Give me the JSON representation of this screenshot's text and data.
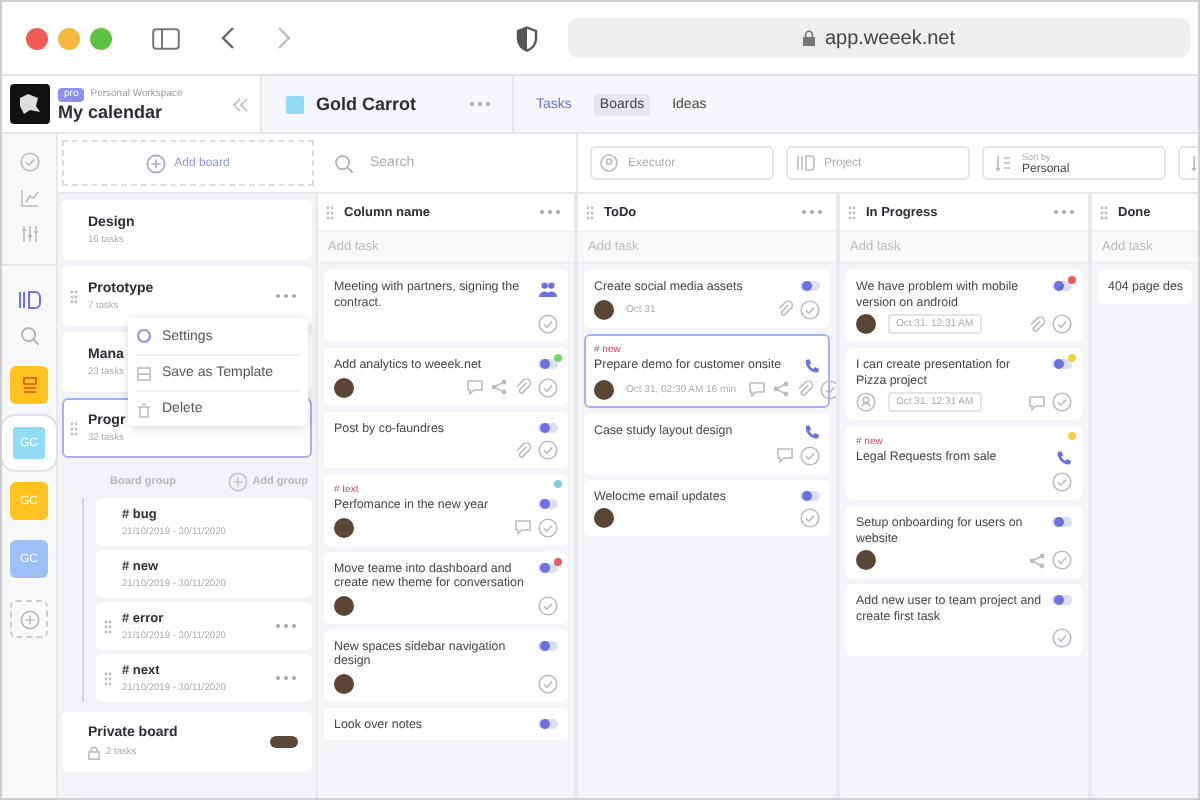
{
  "browser": {
    "address": "app.weeek.net"
  },
  "workspace": {
    "badge": "pro",
    "name": "Personal Workspace",
    "title": "My calendar"
  },
  "project": {
    "title": "Gold Carrot"
  },
  "tabs": [
    {
      "label": "Tasks",
      "kind": "link",
      "selected": false
    },
    {
      "label": "Boards",
      "kind": "tab",
      "selected": true
    },
    {
      "label": "Ideas",
      "kind": "tab",
      "selected": false
    }
  ],
  "rail": {
    "workspaces": [
      {
        "kind": "logo",
        "color": "#ffc31f",
        "selected": false
      },
      {
        "kind": "initials",
        "label": "GC",
        "color": "#8fdcf5",
        "selected": true
      },
      {
        "kind": "initials",
        "label": "GC",
        "color": "#ffc31f",
        "selected": false
      },
      {
        "kind": "initials",
        "label": "GC",
        "color": "#9ec0f7",
        "selected": false
      }
    ]
  },
  "add_board": {
    "label": "Add board"
  },
  "search": {
    "placeholder": "Search"
  },
  "filters": [
    {
      "kind": "executor",
      "placeholder": "Executor"
    },
    {
      "kind": "project",
      "placeholder": "Project"
    },
    {
      "kind": "sort",
      "label": "Sort by",
      "value": "Personal"
    }
  ],
  "boards": [
    {
      "title": "Design",
      "count": "16 tasks",
      "selected": false,
      "menu_open": false
    },
    {
      "title": "Prototype",
      "count": "7 tasks",
      "selected": false,
      "menu_open": true
    },
    {
      "title": "Mana",
      "count": "23 tasks",
      "selected": false,
      "menu_open": false
    },
    {
      "title": "Progr",
      "count": "32 tasks",
      "selected": true,
      "menu_open": false
    }
  ],
  "menu": {
    "items": [
      {
        "kind": "settings",
        "label": "Settings"
      },
      {
        "kind": "template",
        "label": "Save as Template"
      },
      {
        "kind": "delete",
        "label": "Delete"
      }
    ]
  },
  "board_group": {
    "label": "Board group",
    "add_label": "Add group",
    "groups": [
      {
        "title": "# bug",
        "dates": "21/10/2019 - 30/11/2020",
        "draggable": false
      },
      {
        "title": "# new",
        "dates": "21/10/2019 - 30/11/2020",
        "draggable": false
      },
      {
        "title": "# error",
        "dates": "21/10/2019 - 30/11/2020",
        "draggable": true
      },
      {
        "title": "# next",
        "dates": "21/10/2019 - 30/11/2020",
        "draggable": true
      }
    ]
  },
  "private_board": {
    "title": "Private board",
    "count": "2 tasks"
  },
  "columns": [
    {
      "title": "Column name",
      "add_placeholder": "Add task",
      "menu": true,
      "cards": [
        {
          "title": "Meeting with partners, signing the contract.",
          "kind": "meeting",
          "selected": false,
          "check": true
        },
        {
          "title": "Add analytics to weeek.net",
          "kind": "task",
          "color": "#7fd36f",
          "selected": false,
          "avatar": {
            "kind": "photo"
          },
          "comments": true,
          "shared": true,
          "attached": true,
          "check": true
        },
        {
          "title": "Post by co-faundres",
          "kind": "task",
          "selected": false,
          "attached": true,
          "check": true
        },
        {
          "tag": "# text",
          "title": "Perfomance in the new year",
          "kind": "task",
          "color": "#86cbe6",
          "selected": false,
          "avatar": {
            "kind": "photo"
          },
          "comments": true,
          "check": true
        },
        {
          "title": "Move teame into dashboard and create new theme for conversation",
          "kind": "task",
          "color": "#f0595b",
          "selected": false,
          "avatar": {
            "kind": "photo"
          },
          "check": true
        },
        {
          "title": "New spaces sidebar navigation design",
          "kind": "task",
          "selected": false,
          "avatar": {
            "kind": "photo"
          },
          "check": true
        },
        {
          "title": "Look over notes",
          "kind": "task",
          "selected": false
        }
      ]
    },
    {
      "title": "ToDo",
      "add_placeholder": "Add task",
      "menu": true,
      "cards": [
        {
          "title": "Create social media assets",
          "kind": "task",
          "selected": false,
          "avatar": {
            "kind": "photo"
          },
          "date": "Oct 31",
          "date_boxed": false,
          "attached": true,
          "check": true
        },
        {
          "tag": "# new",
          "title": "Prepare demo for customer onsite",
          "kind": "call",
          "selected": true,
          "avatar": {
            "kind": "photo"
          },
          "date": "Oct 31, 02:30 AM 16 min",
          "date_boxed": false,
          "comments": true,
          "shared": true,
          "attached": true,
          "check": true
        },
        {
          "title": "Case study layout design",
          "kind": "call",
          "selected": false,
          "comments": true,
          "check": true
        },
        {
          "title": "Welocme email updates",
          "kind": "task",
          "selected": false,
          "avatar": {
            "kind": "photo"
          },
          "check": true
        }
      ]
    },
    {
      "title": "In Progress",
      "add_placeholder": "Add task",
      "menu": true,
      "cards": [
        {
          "title": "We have problem with mobile version on android",
          "kind": "task",
          "color": "#f0595b",
          "selected": false,
          "avatar": {
            "kind": "photo"
          },
          "date": "Oct 31, 12:31 AM",
          "date_boxed": true,
          "attached": true,
          "check": true
        },
        {
          "title": "I can create presentation for Pizza project",
          "kind": "task",
          "color": "#f5cf3c",
          "selected": false,
          "avatar": {
            "kind": "empty"
          },
          "date": "Oct 31, 12:31 AM",
          "date_boxed": true,
          "comments": true,
          "check": true
        },
        {
          "tag": "# new",
          "title": "Legal Requests from sale",
          "kind": "call",
          "color": "#f5cf3c",
          "selected": false,
          "check": true
        },
        {
          "title": "Setup onboarding for users on website",
          "kind": "task",
          "selected": false,
          "avatar": {
            "kind": "photo"
          },
          "shared": true,
          "check": true
        },
        {
          "title": "Add new user to team project and create first task",
          "kind": "task",
          "selected": false,
          "check": true
        }
      ]
    },
    {
      "title": "Done",
      "add_placeholder": "Add task",
      "cards": [
        {
          "title": "404 page des",
          "kind": "none",
          "selected": false
        }
      ]
    }
  ]
}
